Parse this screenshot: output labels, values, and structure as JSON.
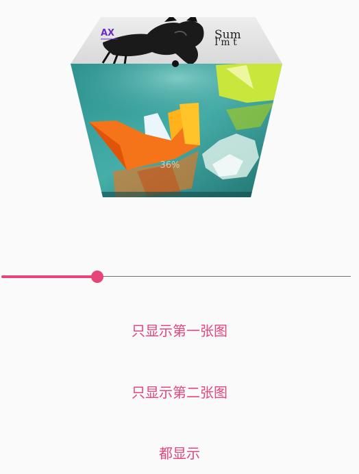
{
  "cube": {
    "top_face_image": "dark-dragon-logo-image",
    "top_face_logo_text": "AX",
    "top_face_side_text": "Sum I'm",
    "front_face_image": "origami-paper-boat-image",
    "progress_text": "36%"
  },
  "slider": {
    "value": 0.275,
    "accent": "#e6457a",
    "track": "#6f6f6f"
  },
  "actions": {
    "show_first": "只显示第一张图",
    "show_second": "只显示第二张图",
    "show_both": "都显示"
  },
  "colors": {
    "accent": "#e6457a",
    "background": "#fafafa"
  }
}
